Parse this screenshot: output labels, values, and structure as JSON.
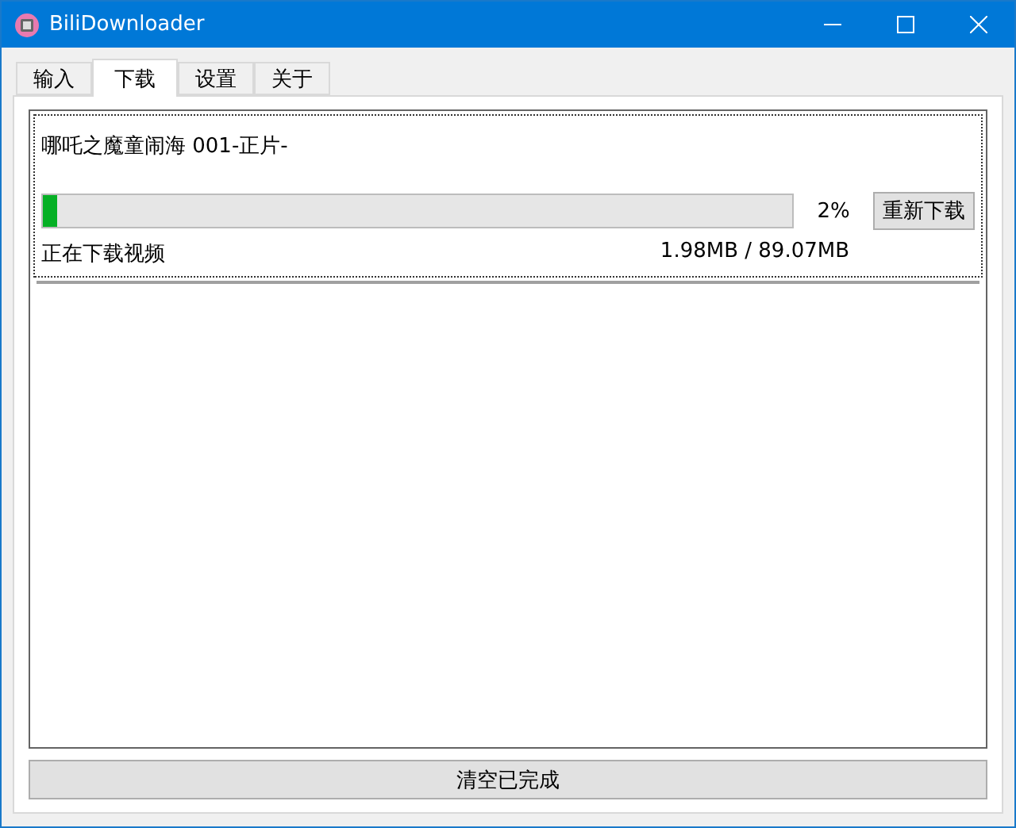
{
  "window": {
    "title": "BiliDownloader"
  },
  "tabs": [
    {
      "label": "输入",
      "selected": false
    },
    {
      "label": "下载",
      "selected": true
    },
    {
      "label": "设置",
      "selected": false
    },
    {
      "label": "关于",
      "selected": false
    }
  ],
  "downloads": [
    {
      "title": "哪吒之魔童闹海 001-正片-",
      "level": 0.02,
      "percent": "2%",
      "button": "重新下载",
      "status": "正在下载视频",
      "size": "1.98MB / 89.07MB"
    }
  ],
  "clear_button": "清空已完成"
}
